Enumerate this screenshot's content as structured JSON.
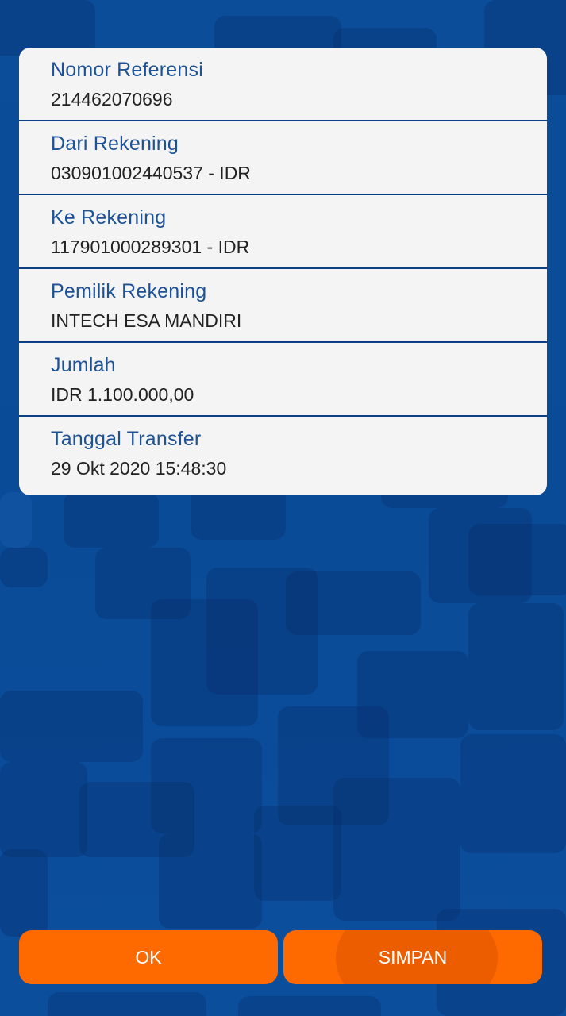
{
  "details": [
    {
      "label": "Nomor Referensi",
      "value": "214462070696"
    },
    {
      "label": "Dari Rekening",
      "value": "030901002440537 - IDR"
    },
    {
      "label": "Ke Rekening",
      "value": "117901000289301 - IDR"
    },
    {
      "label": "Pemilik Rekening",
      "value": "INTECH ESA MANDIRI"
    },
    {
      "label": "Jumlah",
      "value": "IDR 1.100.000,00"
    },
    {
      "label": "Tanggal Transfer",
      "value": "29 Okt 2020 15:48:30"
    }
  ],
  "buttons": {
    "ok_label": "OK",
    "save_label": "SIMPAN"
  },
  "colors": {
    "background": "#0a4a96",
    "card": "#f4f4f4",
    "label": "#1d5296",
    "button": "#ff6a00"
  }
}
